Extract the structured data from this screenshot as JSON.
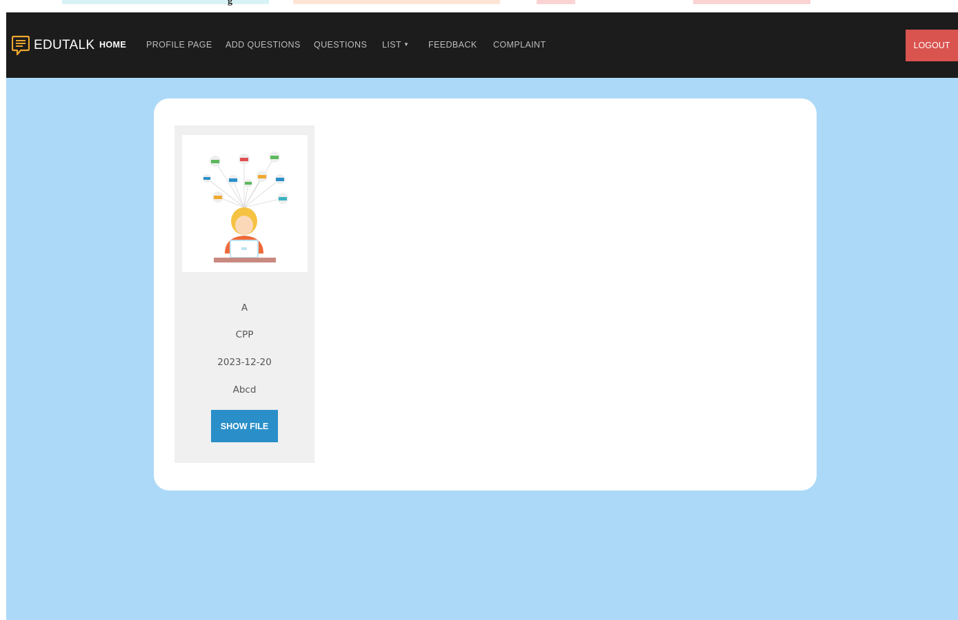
{
  "brand": {
    "name": "EDUTALK",
    "icon": "chat-document-icon"
  },
  "nav": {
    "home": "HOME",
    "profile": "PROFILE PAGE",
    "add_questions": "ADD QUESTIONS",
    "questions": "QUESTIONS",
    "list": "LIST",
    "feedback": "FEEDBACK",
    "complaint": "COMPLAINT"
  },
  "logout_label": "LOGOUT",
  "card": {
    "image_icon": "student-laptop-files-illustration",
    "name": "A",
    "subject": "CPP",
    "date": "2023-12-20",
    "description": "Abcd",
    "button_label": "SHOW FILE"
  },
  "colors": {
    "navbar": "#1c1c1c",
    "background": "#acd9f7",
    "logout": "#d9534f",
    "button": "#2a8fc9",
    "brand_icon": "#f0a830"
  },
  "header_fragment": "g"
}
